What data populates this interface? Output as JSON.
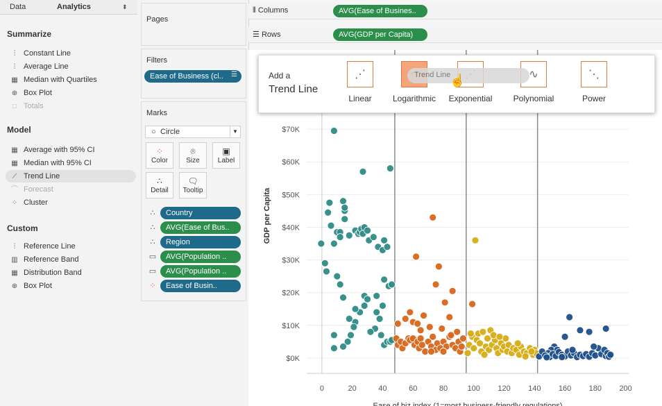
{
  "left_tabs": {
    "data": "Data",
    "analytics": "Analytics"
  },
  "summarize": {
    "title": "Summarize",
    "items": [
      {
        "label": "Constant Line",
        "icon": "constant-line-icon",
        "disabled": false
      },
      {
        "label": "Average Line",
        "icon": "average-line-icon",
        "disabled": false
      },
      {
        "label": "Median with Quartiles",
        "icon": "median-quartiles-icon",
        "disabled": false
      },
      {
        "label": "Box Plot",
        "icon": "box-plot-icon",
        "disabled": false
      },
      {
        "label": "Totals",
        "icon": "totals-icon",
        "disabled": true
      }
    ]
  },
  "model": {
    "title": "Model",
    "items": [
      {
        "label": "Average with 95% CI",
        "icon": "average-ci-icon",
        "disabled": false
      },
      {
        "label": "Median with 95% CI",
        "icon": "median-ci-icon",
        "disabled": false
      },
      {
        "label": "Trend Line",
        "icon": "trend-line-icon",
        "disabled": false
      },
      {
        "label": "Forecast",
        "icon": "forecast-icon",
        "disabled": true
      },
      {
        "label": "Cluster",
        "icon": "cluster-icon",
        "disabled": false
      }
    ]
  },
  "custom": {
    "title": "Custom",
    "items": [
      {
        "label": "Reference Line",
        "icon": "reference-line-icon"
      },
      {
        "label": "Reference Band",
        "icon": "reference-band-icon"
      },
      {
        "label": "Distribution Band",
        "icon": "distribution-band-icon"
      },
      {
        "label": "Box Plot",
        "icon": "box-plot-icon"
      }
    ]
  },
  "cards": {
    "pages": "Pages",
    "filters": "Filters",
    "filter_pill": "Ease of Business (cl..",
    "marks": "Marks",
    "mark_type": "Circle",
    "mark_buttons": {
      "color": "Color",
      "size": "Size",
      "label": "Label",
      "detail": "Detail",
      "tooltip": "Tooltip"
    },
    "mark_fields": [
      {
        "label": "Country",
        "color": "blue",
        "icon": "detail-icon"
      },
      {
        "label": "AVG(Ease of Bus..",
        "color": "green",
        "icon": "detail-icon"
      },
      {
        "label": "Region",
        "color": "blue",
        "icon": "detail-icon"
      },
      {
        "label": "AVG(Population ..",
        "color": "green",
        "icon": "tooltip-icon"
      },
      {
        "label": "AVG(Population ..",
        "color": "green",
        "icon": "tooltip-icon"
      },
      {
        "label": "Ease of Busin..",
        "color": "blue",
        "icon": "color-icon"
      }
    ]
  },
  "shelves": {
    "columns_label": "Columns",
    "columns_pill": "AVG(Ease of Busines..",
    "rows_label": "Rows",
    "rows_pill": "AVG(GDP per Capita)"
  },
  "trend_popup": {
    "add_a": "Add a",
    "title": "Trend Line",
    "drag_label": "Trend Line",
    "options": [
      "Linear",
      "Logarithmic",
      "Exponential",
      "Polynomial",
      "Power"
    ],
    "selected": "Logarithmic",
    "accent": "#e07a3f"
  },
  "chart_data": {
    "type": "scatter",
    "xlabel": "Ease of biz index (1=most business-friendly regulations)",
    "ylabel": "GDP per Capita",
    "xlim": [
      -10,
      202
    ],
    "ylim": [
      -3000,
      73000
    ],
    "xticks": [
      0,
      20,
      40,
      60,
      80,
      100,
      120,
      140,
      160,
      180,
      200
    ],
    "yticks": [
      0,
      10000,
      20000,
      30000,
      40000,
      50000,
      60000,
      70000
    ],
    "ytick_labels": [
      "$0K",
      "$10K",
      "$20K",
      "$30K",
      "$40K",
      "$50K",
      "$60K",
      "$70K"
    ],
    "cluster_boundaries": [
      48,
      95,
      142
    ],
    "series": [
      {
        "color": "#2e8b85",
        "points": [
          [
            8,
            69500
          ],
          [
            27,
            57000
          ],
          [
            45,
            58000
          ],
          [
            -0.5,
            35000
          ],
          [
            2,
            29000
          ],
          [
            3,
            26500
          ],
          [
            4,
            44500
          ],
          [
            5,
            47500
          ],
          [
            6,
            40500
          ],
          [
            8,
            35000
          ],
          [
            10,
            38500
          ],
          [
            12,
            38500
          ],
          [
            12,
            37000
          ],
          [
            14,
            48000
          ],
          [
            15,
            45000
          ],
          [
            15,
            46000
          ],
          [
            15,
            42500
          ],
          [
            18,
            37500
          ],
          [
            22,
            39000
          ],
          [
            24,
            38000
          ],
          [
            25,
            38500
          ],
          [
            26,
            39500
          ],
          [
            27,
            38000
          ],
          [
            28,
            40000
          ],
          [
            30,
            39000
          ],
          [
            31,
            36000
          ],
          [
            34,
            37000
          ],
          [
            37,
            34000
          ],
          [
            40,
            33000
          ],
          [
            41,
            36000
          ],
          [
            43,
            34000
          ],
          [
            44,
            22000
          ],
          [
            46,
            22500
          ],
          [
            41,
            24000
          ],
          [
            36,
            14000
          ],
          [
            28,
            16000
          ],
          [
            25,
            14000
          ],
          [
            22,
            11000
          ],
          [
            21,
            9500
          ],
          [
            19,
            7000
          ],
          [
            17,
            5000
          ],
          [
            14,
            18500
          ],
          [
            14,
            3500
          ],
          [
            12,
            22500
          ],
          [
            10,
            25000
          ],
          [
            8,
            7000
          ],
          [
            8,
            3000
          ],
          [
            18,
            12000
          ],
          [
            22,
            15000
          ],
          [
            28,
            19000
          ],
          [
            30,
            18000
          ],
          [
            36,
            19000
          ],
          [
            38,
            12000
          ],
          [
            40,
            16000
          ],
          [
            41,
            4000
          ],
          [
            43,
            5000
          ],
          [
            45,
            5000
          ],
          [
            46,
            5500
          ],
          [
            35,
            9000
          ],
          [
            32,
            8000
          ],
          [
            39,
            7000
          ]
        ]
      },
      {
        "color": "#d9661a",
        "points": [
          [
            73,
            43000
          ],
          [
            62,
            31000
          ],
          [
            77,
            28000
          ],
          [
            75,
            22500
          ],
          [
            86,
            20500
          ],
          [
            81,
            17000
          ],
          [
            84,
            12500
          ],
          [
            99,
            16500
          ],
          [
            58,
            14000
          ],
          [
            55,
            12000
          ],
          [
            60,
            11000
          ],
          [
            63,
            10500
          ],
          [
            67,
            13000
          ],
          [
            50,
            10500
          ],
          [
            49,
            6000
          ],
          [
            50,
            4000
          ],
          [
            52,
            5000
          ],
          [
            53,
            3000
          ],
          [
            55,
            4500
          ],
          [
            57,
            6000
          ],
          [
            58,
            5500
          ],
          [
            60,
            6000
          ],
          [
            61,
            4000
          ],
          [
            63,
            5000
          ],
          [
            64,
            3000
          ],
          [
            65,
            6000
          ],
          [
            66,
            4000
          ],
          [
            68,
            2000
          ],
          [
            70,
            5000
          ],
          [
            72,
            3500
          ],
          [
            73,
            6500
          ],
          [
            75,
            2500
          ],
          [
            76,
            4500
          ],
          [
            78,
            3000
          ],
          [
            80,
            5000
          ],
          [
            82,
            3500
          ],
          [
            84,
            6500
          ],
          [
            86,
            4000
          ],
          [
            88,
            3000
          ],
          [
            90,
            5000
          ],
          [
            91,
            2000
          ],
          [
            92,
            3500
          ],
          [
            93,
            6000
          ],
          [
            89,
            8000
          ],
          [
            85,
            7000
          ],
          [
            79,
            9000
          ],
          [
            71,
            9500
          ],
          [
            65,
            8500
          ],
          [
            72,
            2000
          ],
          [
            80,
            2000
          ]
        ]
      },
      {
        "color": "#d6ac14",
        "points": [
          [
            101,
            36000
          ],
          [
            97,
            4000
          ],
          [
            99,
            6500
          ],
          [
            100,
            3000
          ],
          [
            102,
            5500
          ],
          [
            103,
            7500
          ],
          [
            104,
            4500
          ],
          [
            105,
            2000
          ],
          [
            106,
            8000
          ],
          [
            108,
            3500
          ],
          [
            109,
            6000
          ],
          [
            110,
            2500
          ],
          [
            112,
            4000
          ],
          [
            114,
            5500
          ],
          [
            115,
            3000
          ],
          [
            116,
            1500
          ],
          [
            118,
            4500
          ],
          [
            119,
            2500
          ],
          [
            120,
            3500
          ],
          [
            122,
            2000
          ],
          [
            123,
            4000
          ],
          [
            125,
            1500
          ],
          [
            126,
            3000
          ],
          [
            128,
            2500
          ],
          [
            130,
            1000
          ],
          [
            131,
            3500
          ],
          [
            133,
            2000
          ],
          [
            135,
            1500
          ],
          [
            137,
            3000
          ],
          [
            139,
            1000
          ],
          [
            140,
            2500
          ],
          [
            141,
            1500
          ],
          [
            96,
            1500
          ],
          [
            98,
            7500
          ],
          [
            107,
            1000
          ],
          [
            111,
            8500
          ],
          [
            121,
            6000
          ],
          [
            129,
            4500
          ],
          [
            134,
            500
          ],
          [
            138,
            2000
          ],
          [
            113,
            7000
          ],
          [
            117,
            6500
          ]
        ]
      },
      {
        "color": "#1d4e89",
        "points": [
          [
            163,
            12500
          ],
          [
            170,
            8500
          ],
          [
            176,
            8000
          ],
          [
            187,
            9000
          ],
          [
            160,
            6500
          ],
          [
            153,
            3500
          ],
          [
            151,
            2500
          ],
          [
            155,
            2500
          ],
          [
            149,
            1500
          ],
          [
            146,
            1000
          ],
          [
            143,
            500
          ],
          [
            145,
            2000
          ],
          [
            147,
            800
          ],
          [
            150,
            300
          ],
          [
            152,
            1200
          ],
          [
            154,
            600
          ],
          [
            156,
            1800
          ],
          [
            158,
            1000
          ],
          [
            160,
            500
          ],
          [
            162,
            2000
          ],
          [
            164,
            800
          ],
          [
            166,
            1500
          ],
          [
            168,
            300
          ],
          [
            170,
            1000
          ],
          [
            172,
            600
          ],
          [
            174,
            1200
          ],
          [
            176,
            400
          ],
          [
            178,
            1500
          ],
          [
            180,
            800
          ],
          [
            182,
            3000
          ],
          [
            184,
            1200
          ],
          [
            186,
            2500
          ],
          [
            187,
            600
          ],
          [
            188,
            1500
          ],
          [
            189,
            400
          ],
          [
            190,
            1000
          ],
          [
            158,
            300
          ],
          [
            165,
            2500
          ],
          [
            179,
            3500
          ],
          [
            148,
            200
          ]
        ]
      }
    ]
  }
}
